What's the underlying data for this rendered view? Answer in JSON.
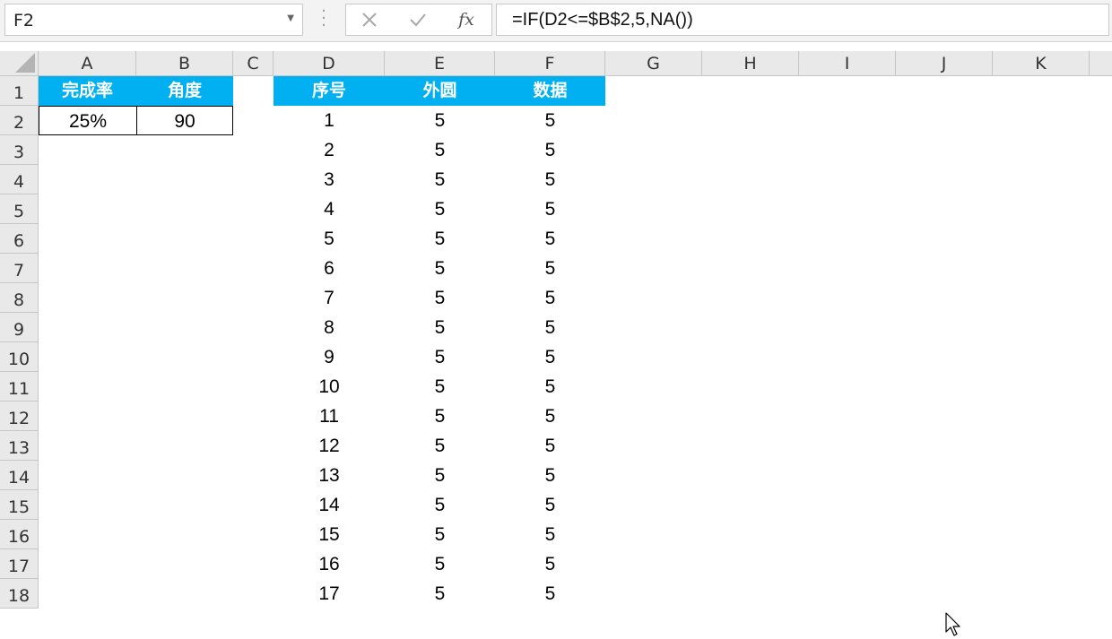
{
  "formula_bar": {
    "name_box": "F2",
    "fx_label": "fx",
    "formula": "=IF(D2<=$B$2,5,NA())"
  },
  "columns": [
    "A",
    "B",
    "C",
    "D",
    "E",
    "F",
    "G",
    "H",
    "I",
    "J",
    "K"
  ],
  "rows": [
    "1",
    "2",
    "3",
    "4",
    "5",
    "6",
    "7",
    "8",
    "9",
    "10",
    "11",
    "12",
    "13",
    "14",
    "15",
    "16",
    "17",
    "18"
  ],
  "table1": {
    "headers": [
      "完成率",
      "角度"
    ],
    "values": [
      "25%",
      "90"
    ]
  },
  "table2": {
    "headers": [
      "序号",
      "外圆",
      "数据"
    ],
    "rows": [
      [
        "1",
        "5",
        "5"
      ],
      [
        "2",
        "5",
        "5"
      ],
      [
        "3",
        "5",
        "5"
      ],
      [
        "4",
        "5",
        "5"
      ],
      [
        "5",
        "5",
        "5"
      ],
      [
        "6",
        "5",
        "5"
      ],
      [
        "7",
        "5",
        "5"
      ],
      [
        "8",
        "5",
        "5"
      ],
      [
        "9",
        "5",
        "5"
      ],
      [
        "10",
        "5",
        "5"
      ],
      [
        "11",
        "5",
        "5"
      ],
      [
        "12",
        "5",
        "5"
      ],
      [
        "13",
        "5",
        "5"
      ],
      [
        "14",
        "5",
        "5"
      ],
      [
        "15",
        "5",
        "5"
      ],
      [
        "16",
        "5",
        "5"
      ],
      [
        "17",
        "5",
        "5"
      ]
    ]
  },
  "colors": {
    "header_fill": "#00b0f0",
    "header_text": "#ffffff"
  }
}
